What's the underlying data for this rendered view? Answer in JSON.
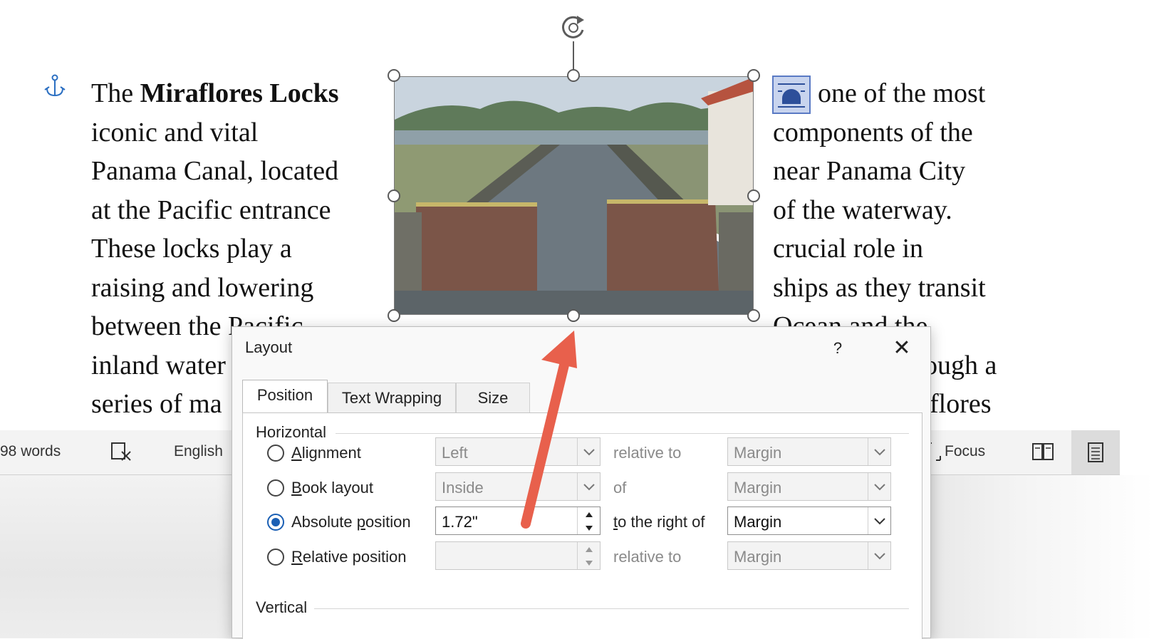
{
  "document": {
    "left_lines": [
      {
        "pre": "The ",
        "bold": "Miraflores Locks",
        "post": ""
      },
      {
        "pre": "iconic and vital",
        "bold": "",
        "post": ""
      },
      {
        "pre": "Panama Canal, located",
        "bold": "",
        "post": ""
      },
      {
        "pre": "at the Pacific entrance",
        "bold": "",
        "post": ""
      },
      {
        "pre": "These locks play a",
        "bold": "",
        "post": ""
      },
      {
        "pre": "raising and lowering",
        "bold": "",
        "post": ""
      },
      {
        "pre": "between the Pacific",
        "bold": "",
        "post": ""
      },
      {
        "pre": "inland water",
        "bold": "",
        "post": ""
      },
      {
        "pre": "series of ma",
        "bold": "",
        "post": ""
      }
    ],
    "right_lines": [
      "one of the most",
      "components of the",
      "near Panama City",
      "of the waterway.",
      "crucial role in",
      "ships as they transit",
      "Ocean and the",
      "ough a",
      "flores"
    ]
  },
  "status_bar": {
    "word_count": "98 words",
    "language": "English",
    "focus": "Focus"
  },
  "dialog": {
    "title": "Layout",
    "help": "?",
    "close": "✕",
    "tabs": [
      "Position",
      "Text Wrapping",
      "Size"
    ],
    "active_tab": "Position",
    "horizontal": {
      "heading": "Horizontal",
      "rows": [
        {
          "key": "A",
          "rest": "lignment",
          "value": "Left",
          "mid": "relative to",
          "target": "Margin",
          "checked": false,
          "kind": "combo"
        },
        {
          "key": "B",
          "rest": "ook layout",
          "value": "Inside",
          "mid": "of",
          "target": "Margin",
          "checked": false,
          "kind": "combo"
        },
        {
          "pre": "Absolute ",
          "key": "p",
          "rest": "osition",
          "value": "1.72\"",
          "mid_key": "t",
          "mid": "o the right of",
          "target": "Margin",
          "checked": true,
          "kind": "spin"
        },
        {
          "key": "R",
          "rest": "elative position",
          "value": "",
          "mid": "relative to",
          "target": "Margin",
          "checked": false,
          "kind": "spin"
        }
      ]
    },
    "vertical": {
      "heading": "Vertical"
    }
  },
  "colors": {
    "accent": "#1a5fb4",
    "arrow": "#e8604c"
  }
}
